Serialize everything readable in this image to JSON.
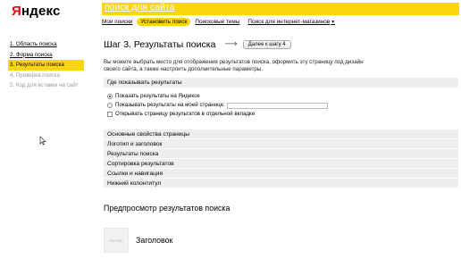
{
  "logo": {
    "first_letter": "Я",
    "rest": "ндекс"
  },
  "header": {
    "title": "поиск для сайта"
  },
  "topnav": {
    "items": [
      {
        "label": "Мои поиски",
        "active": false
      },
      {
        "label": "Установить поиск",
        "active": true
      },
      {
        "label": "Поисковые темы",
        "active": false
      },
      {
        "label": "Поиск для интернет-магазинов",
        "active": false,
        "has_dropdown": true
      }
    ]
  },
  "sidebar": {
    "steps": [
      {
        "label": "1. Область поиска",
        "state": "link"
      },
      {
        "label": "2. Форма поиска",
        "state": "link"
      },
      {
        "label": "3. Результаты поиска",
        "state": "active"
      },
      {
        "label": "4. Проверка поиска",
        "state": "muted"
      },
      {
        "label": "5. Код для вставки на сайт",
        "state": "muted"
      }
    ]
  },
  "main": {
    "step_title": "Шаг 3. Результаты поиска",
    "arrow": "⟶",
    "next_button": "Далее к шагу 4",
    "intro": "Вы можете выбрать место для отображения результатов поиска, оформить эту страницу под дизайн своего сайта, а также настроить дополнительные параметры.",
    "placement": {
      "title": "Где показывать результаты",
      "option_yandex": "Показать результаты на Яндексе",
      "option_mypage": "Показывать результаты на моей странице:",
      "mypage_value": "",
      "newtab": "Открывать страницу результатов в отдельной вкладке"
    },
    "accordion": [
      "Основные свойства страницы",
      "Логотип и заголовок",
      "Результаты поиска",
      "Сортировка результатов",
      "Ссылки и навигация",
      "Нижний колонтитул"
    ],
    "preview": {
      "title": "Предпросмотр результатов поиска",
      "thumb_label": "Логотип",
      "heading": "Заголовок"
    }
  }
}
